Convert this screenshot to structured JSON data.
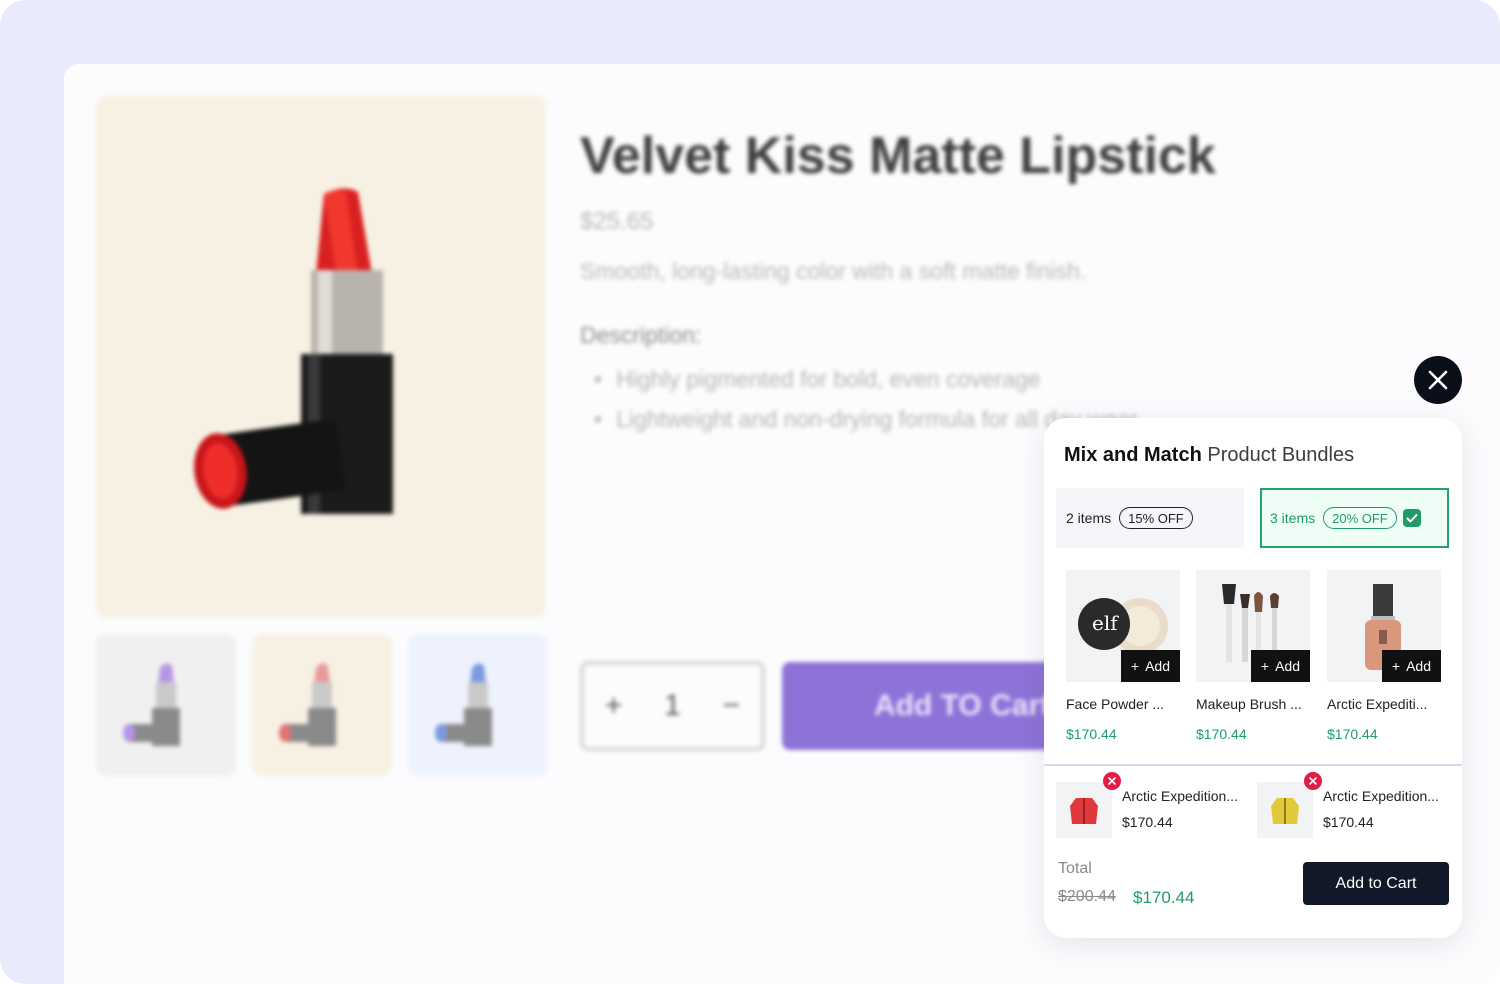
{
  "product": {
    "title": "Velvet Kiss Matte Lipstick",
    "price": "$25.65",
    "subtitle": "Smooth, long-lasting color with a soft matte finish.",
    "description_label": "Description:",
    "bullets": [
      "Highly pigmented for bold, even coverage",
      "Lightweight and non-drying formula for all day wear"
    ],
    "quantity": "1",
    "qty_plus": "+",
    "qty_minus": "−",
    "add_to_cart": "Add TO Cart",
    "colors": {
      "main_lipstick": "#e3201f",
      "thumb_colors": [
        "#b795e6",
        "#e79a9a",
        "#7a9ae2"
      ]
    }
  },
  "bundle_panel": {
    "title_strong": "Mix and Match",
    "title_rest": " Product Bundles",
    "tiers": [
      {
        "items": "2 items",
        "discount": "15% OFF",
        "selected": false
      },
      {
        "items": "3 items",
        "discount": "20% OFF",
        "selected": true
      }
    ],
    "add_label": "Add",
    "products": [
      {
        "name": "Face Powder ...",
        "price": "$170.44",
        "icon": "face-powder"
      },
      {
        "name": "Makeup Brush ...",
        "price": "$170.44",
        "icon": "makeup-brush"
      },
      {
        "name": "Arctic Expediti...",
        "price": "$170.44",
        "icon": "foundation-bottle"
      }
    ],
    "selected": [
      {
        "name": "Arctic Expedition...",
        "price": "$170.44",
        "icon": "red-jacket"
      },
      {
        "name": "Arctic Expedition...",
        "price": "$170.44",
        "icon": "yellow-jacket"
      }
    ],
    "total_label": "Total",
    "total_original": "$200.44",
    "total_discounted": "$170.44",
    "add_to_cart": "Add to Cart",
    "accent_color": "#1f9c63"
  }
}
